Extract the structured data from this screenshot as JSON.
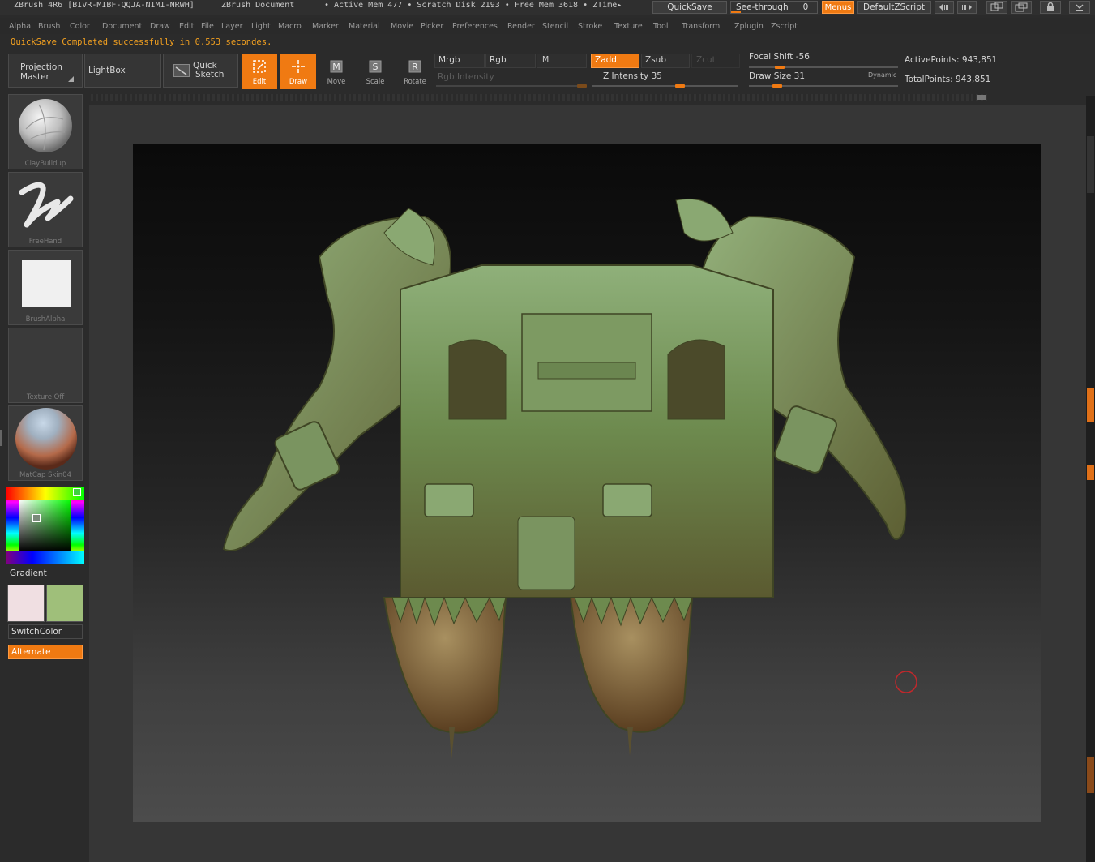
{
  "titlebar": {
    "app": "ZBrush 4R6 [BIVR-MIBF-QQJA-NIMI-NRWH]",
    "doc": "ZBrush Document",
    "mem": "• Active Mem 477 • Scratch Disk 2193 • Free Mem 3618 • ZTime▸",
    "quicksave": "QuickSave",
    "seethrough": "See-through",
    "seethrough_value": "0",
    "menus": "Menus",
    "script": "DefaultZScript"
  },
  "menubar": {
    "items": [
      "Alpha",
      "Brush",
      "Color",
      "Document",
      "Draw",
      "Edit",
      "File",
      "Layer",
      "Light",
      "Macro",
      "Marker",
      "Material",
      "Movie",
      "Picker",
      "Preferences",
      "Render",
      "Stencil",
      "Stroke",
      "Texture",
      "Tool",
      "Transform",
      "Zplugin",
      "Zscript"
    ]
  },
  "status": "QuickSave Completed successfully in 0.553 secondes.",
  "shelf": {
    "projection_master": [
      "Projection",
      "Master"
    ],
    "lightbox": "LightBox",
    "quick_sketch": [
      "Quick",
      "Sketch"
    ],
    "edit": "Edit",
    "draw": "Draw",
    "move": "Move",
    "scale": "Scale",
    "rotate": "Rotate",
    "mrgb": "Mrgb",
    "rgb": "Rgb",
    "m": "M",
    "rgb_intensity": "Rgb Intensity",
    "zadd": "Zadd",
    "zsub": "Zsub",
    "zcut": "Zcut",
    "z_intensity": "Z Intensity 35",
    "focal_shift": "Focal Shift -56",
    "draw_size": "Draw Size 31",
    "dynamic": "Dynamic",
    "active_points": "ActivePoints: 943,851",
    "total_points": "TotalPoints: 943,851"
  },
  "left": {
    "brush": "ClayBuildup",
    "stroke": "FreeHand",
    "alpha": "BrushAlpha",
    "texture": "Texture Off",
    "material": "MatCap Skin04",
    "gradient": "Gradient",
    "switch_color": "SwitchColor",
    "alternate": "Alternate",
    "colors": {
      "main": "#f0dfe2",
      "secondary": "#9fbf7a"
    }
  },
  "colors": {
    "accent": "#f07a12",
    "model_green": "#7f9a5a",
    "cursor_ring": "#c0282c"
  }
}
